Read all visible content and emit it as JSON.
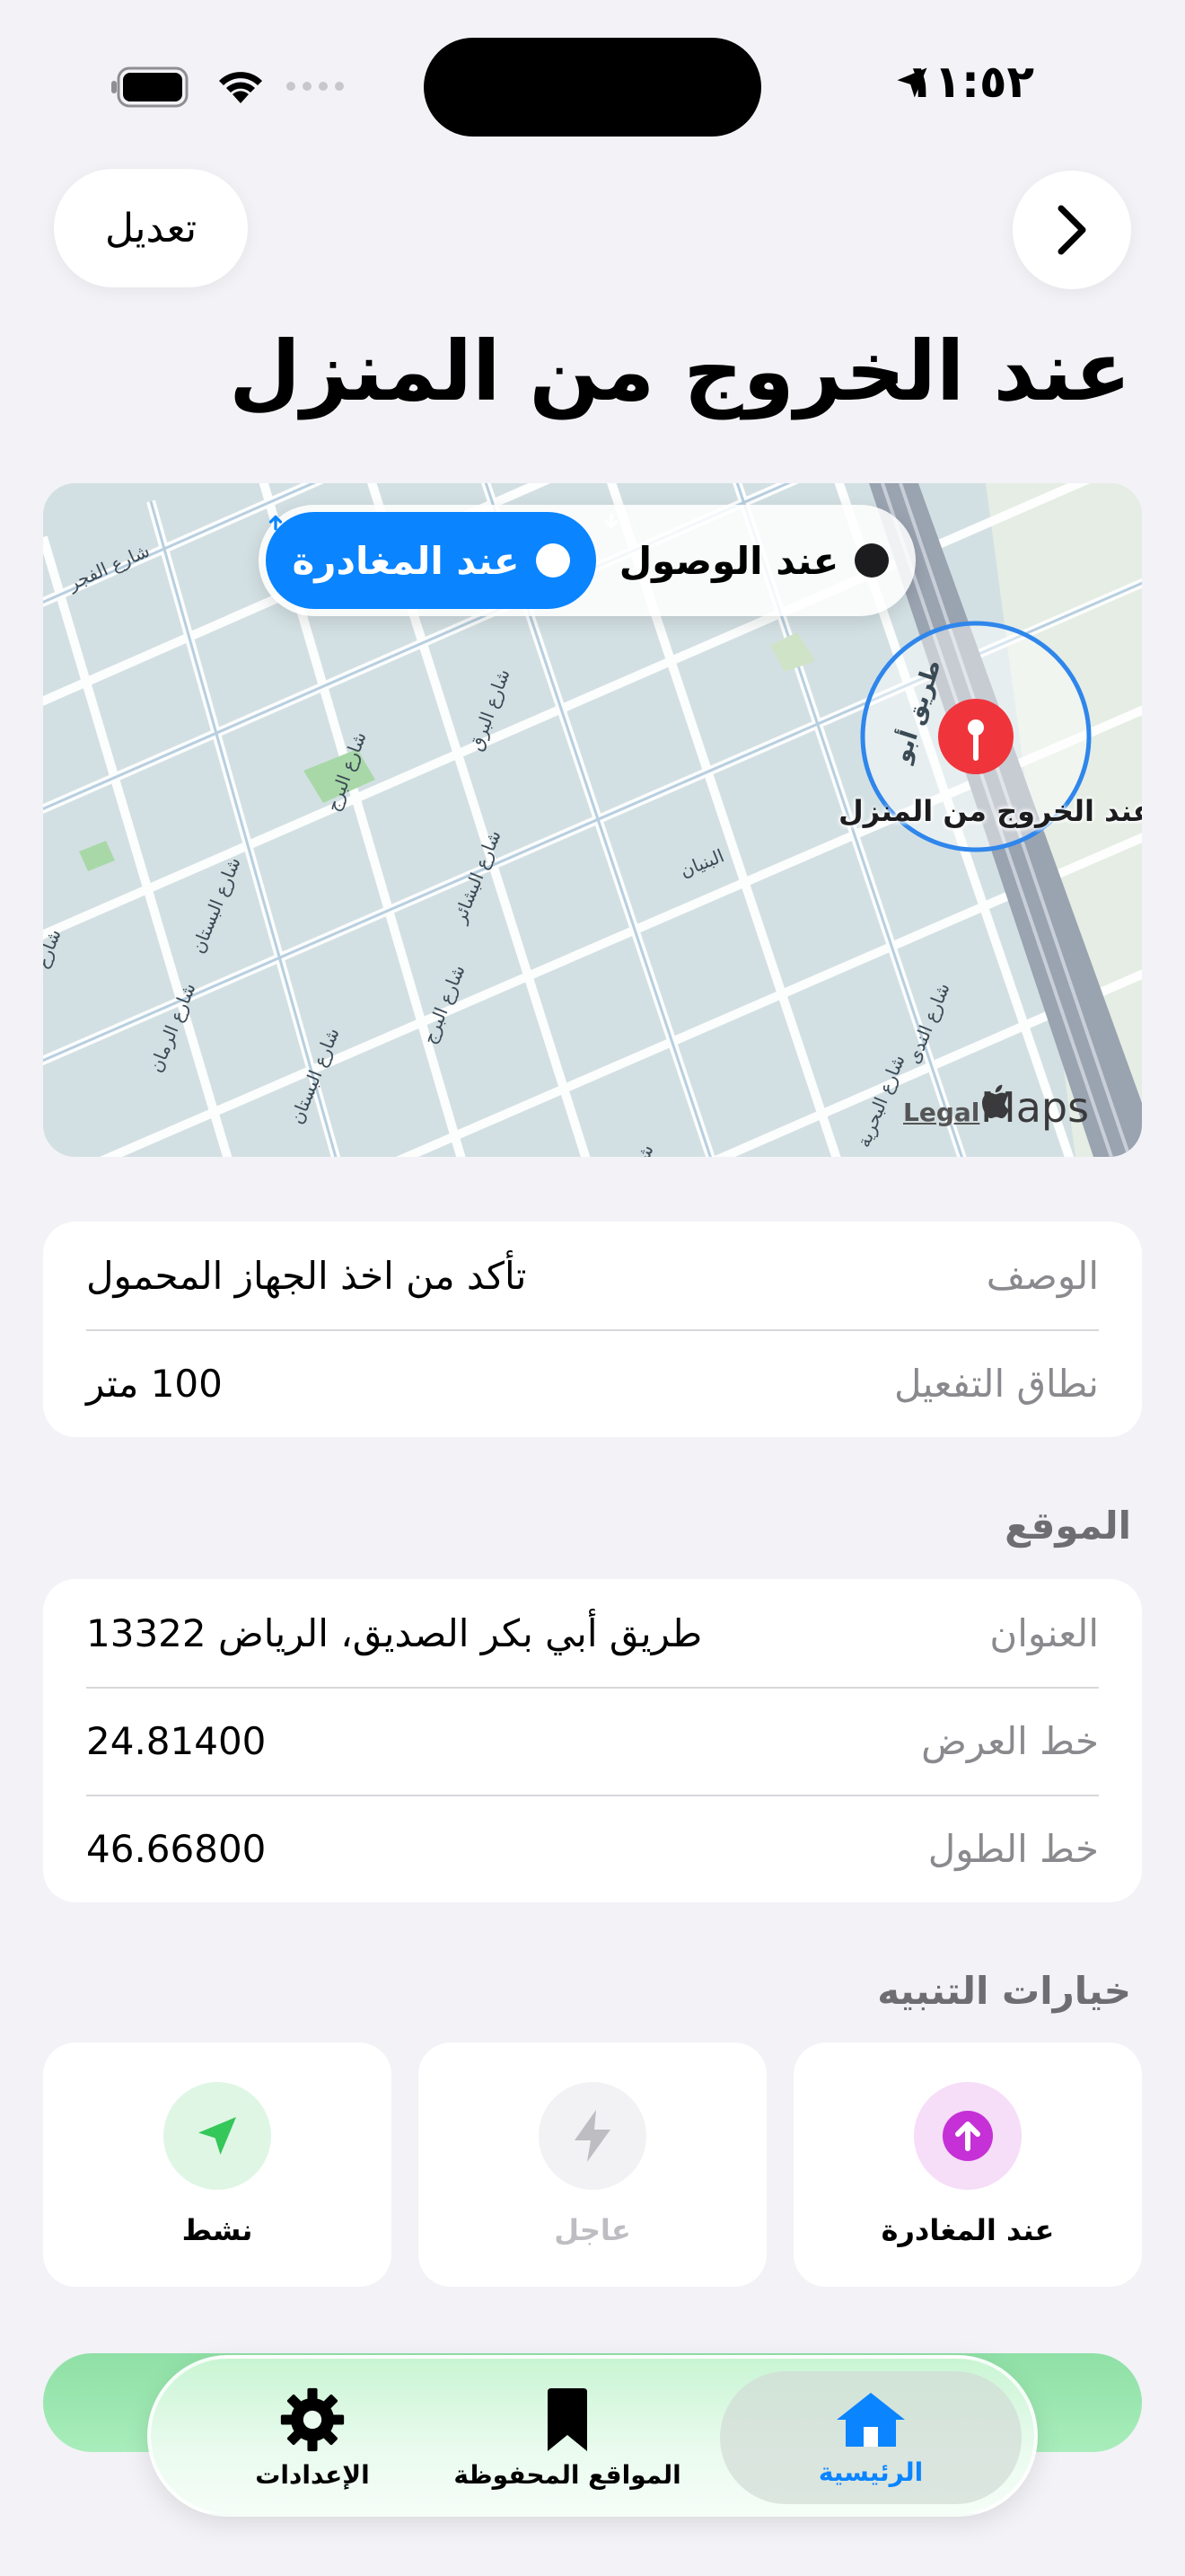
{
  "status_bar": {
    "time": "١١:٥٢"
  },
  "nav": {
    "edit_label": "تعديل"
  },
  "title": "عند الخروج من المنزل",
  "map": {
    "segment": {
      "depart_label": "عند المغادرة",
      "arrive_label": "عند الوصول",
      "selected": "depart"
    },
    "pin_label": "عند الخروج من المنزل",
    "legal": "Legal",
    "brand": "Maps",
    "street_labels": [
      "شارع الفجر",
      "شارع البرق",
      "شارع البرج",
      "شارع البستان",
      "شارع الرمان",
      "شارع البشائر",
      "شارع البرج",
      "شارع البستان",
      "البنيان",
      "شارع الندى",
      "شارع البحرية",
      "شارع أشهر",
      "شارع البشائر",
      "طريق أبو"
    ]
  },
  "details": [
    {
      "label": "الوصف",
      "value": "تأكد من اخذ الجهاز المحمول"
    },
    {
      "label": "نطاق التفعيل",
      "value": "100 متر"
    }
  ],
  "location_section": {
    "header": "الموقع",
    "rows": [
      {
        "label": "العنوان",
        "value": "طريق أبي بكر الصديق، الرياض 13322"
      },
      {
        "label": "خط العرض",
        "value": "24.81400"
      },
      {
        "label": "خط الطول",
        "value": "46.66800"
      }
    ]
  },
  "alert_section": {
    "header": "خيارات التنبيه",
    "options": [
      {
        "label": "عند المغادرة",
        "icon": "arrow-up-circle-icon",
        "color": "#C531D6",
        "bg": "#F6DDF8",
        "enabled": true
      },
      {
        "label": "عاجل",
        "icon": "bolt-icon",
        "color": "#BDBDC2",
        "bg": "#F2F2F4",
        "enabled": false
      },
      {
        "label": "نشط",
        "icon": "location-arrow-icon",
        "color": "#34C759",
        "bg": "#DFF6E5",
        "enabled": true
      }
    ]
  },
  "tabbar": {
    "tabs": [
      {
        "label": "الرئيسية",
        "icon": "house-icon",
        "active": true
      },
      {
        "label": "المواقع المحفوظة",
        "icon": "bookmark-icon",
        "active": false
      },
      {
        "label": "الإعدادات",
        "icon": "gear-icon",
        "active": false
      }
    ],
    "colors": {
      "active": "#0A84FF",
      "inactive": "#000000"
    }
  }
}
